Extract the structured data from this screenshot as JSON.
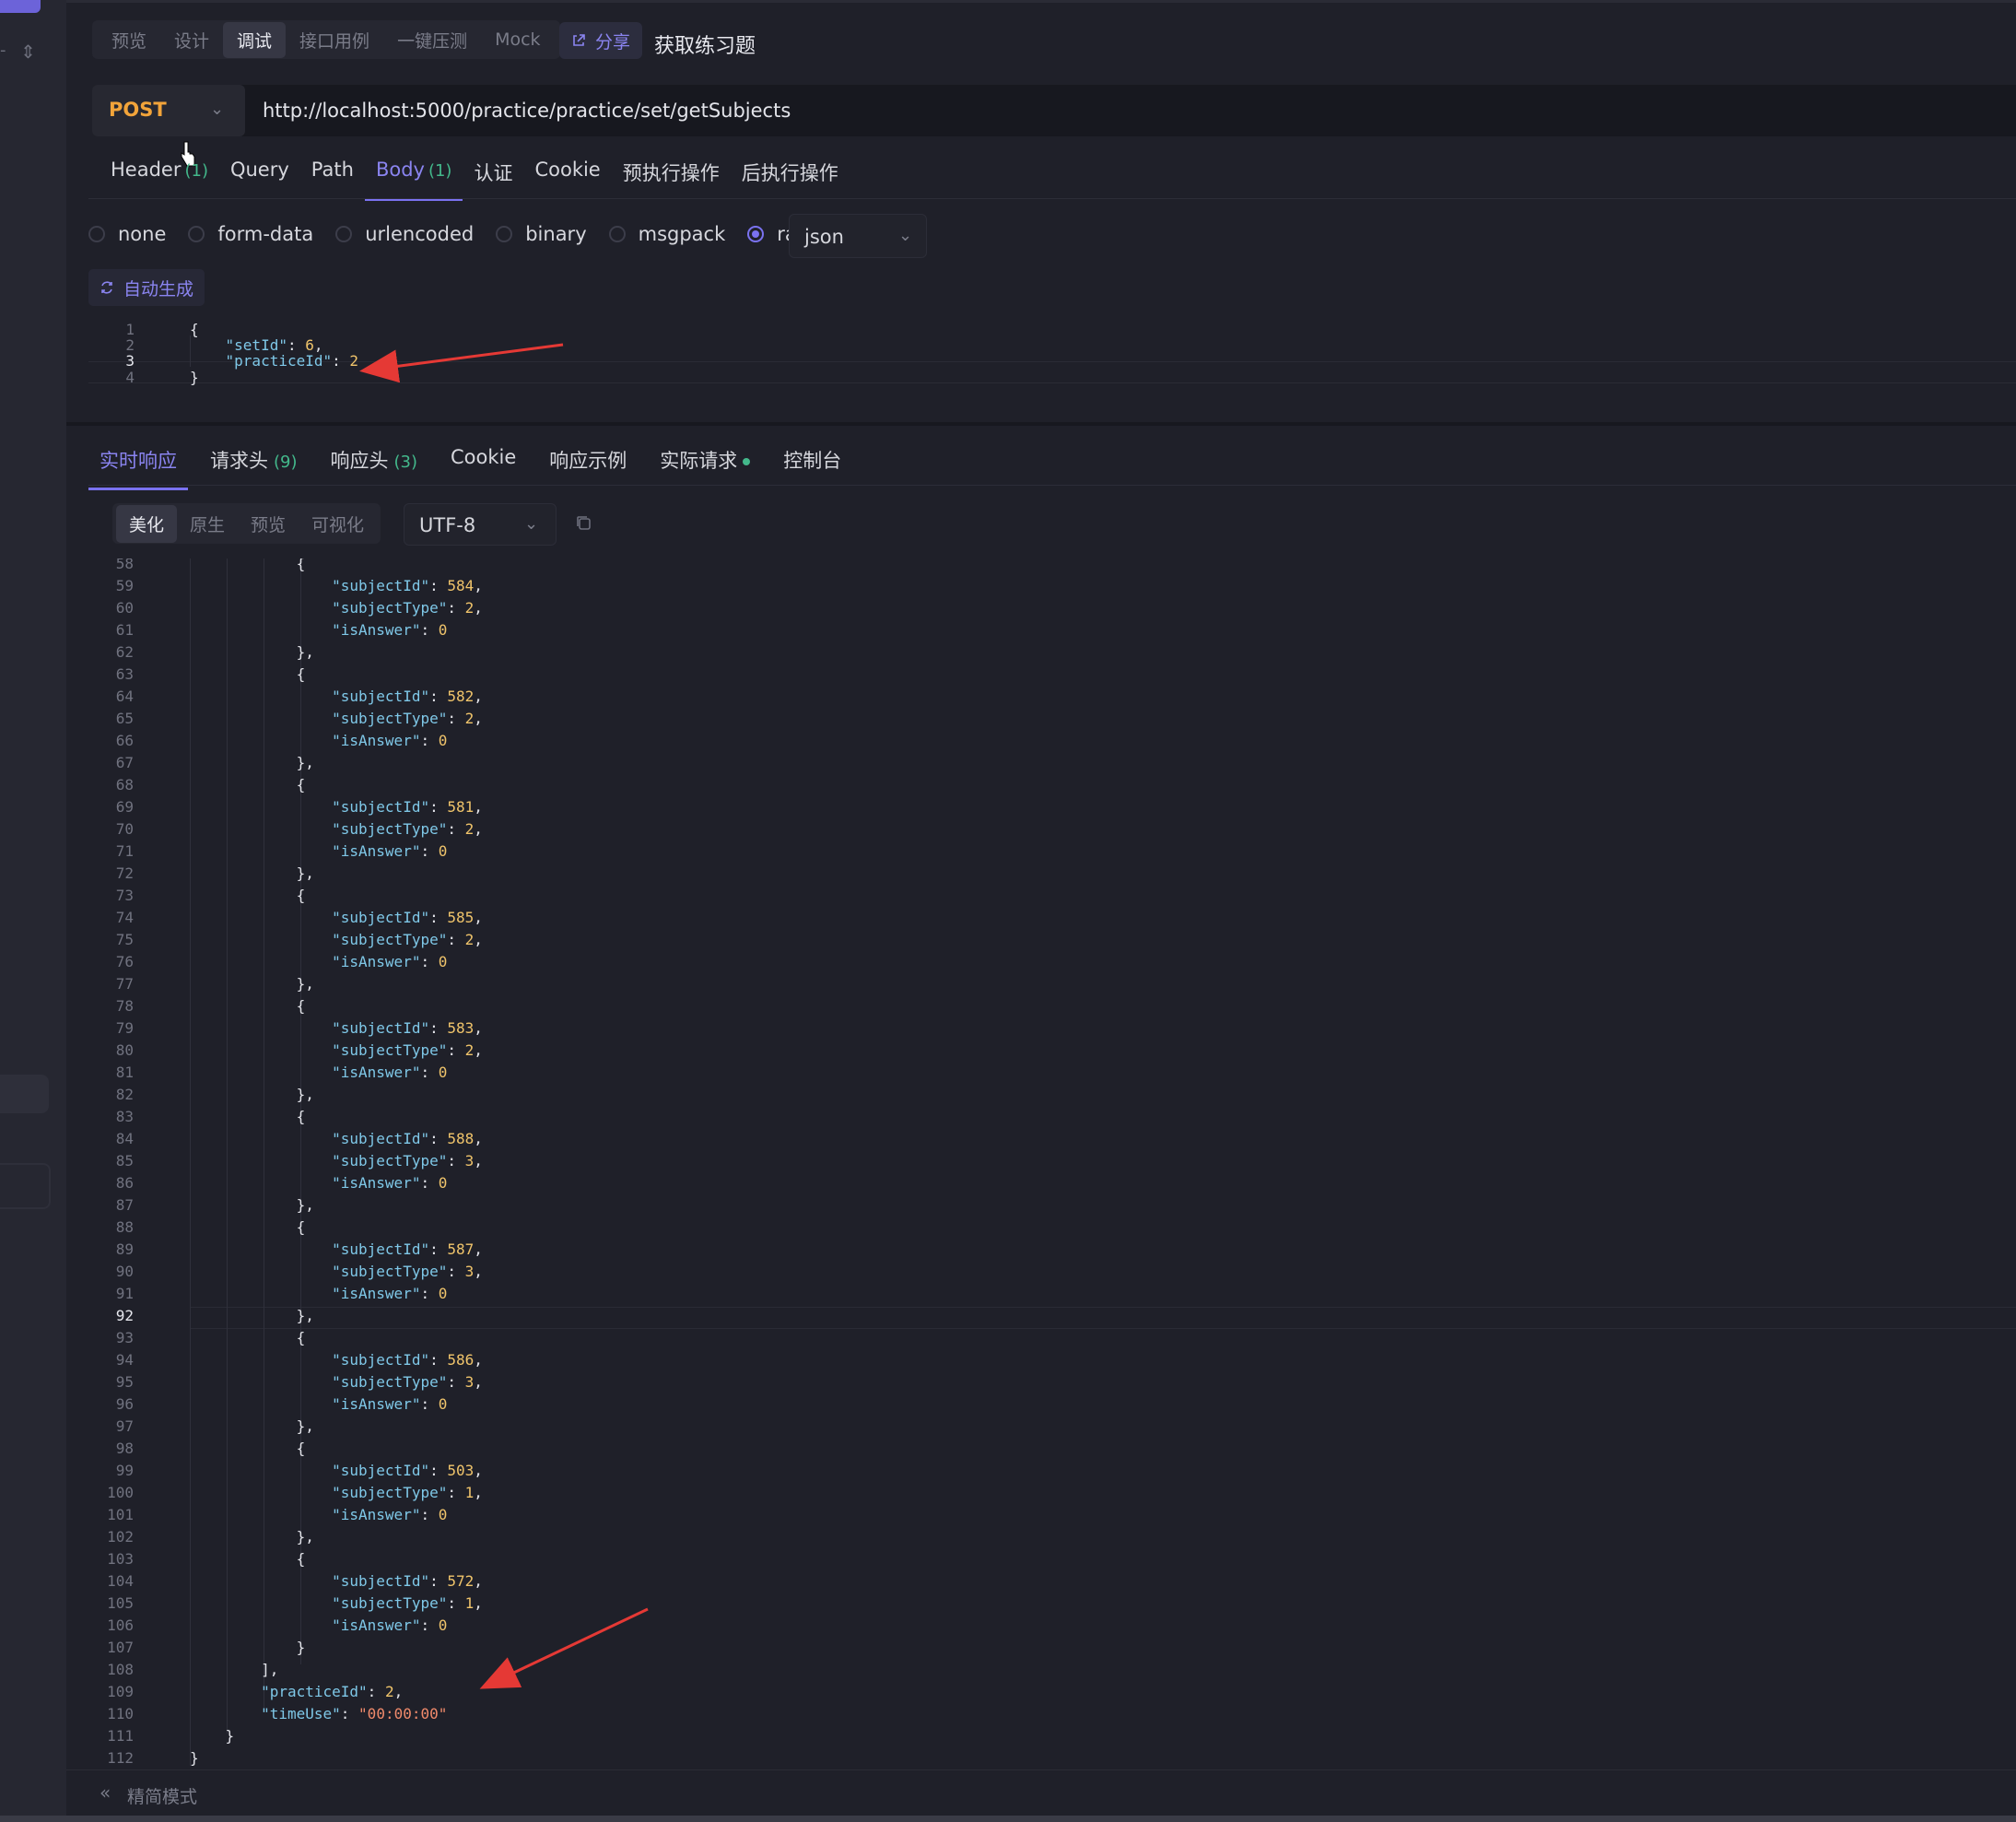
{
  "mode_tabs": [
    "预览",
    "设计",
    "调试",
    "接口用例",
    "一键压测",
    "Mock"
  ],
  "share_label": "分享",
  "api_title": "获取练习题",
  "method": "POST",
  "url": "http://localhost:5000/practice/practice/set/getSubjects",
  "request_tabs": [
    {
      "label": "Header",
      "count": "(1)"
    },
    {
      "label": "Query",
      "count": ""
    },
    {
      "label": "Path",
      "count": ""
    },
    {
      "label": "Body",
      "count": "(1)"
    },
    {
      "label": "认证",
      "count": ""
    },
    {
      "label": "Cookie",
      "count": ""
    },
    {
      "label": "预执行操作",
      "count": ""
    },
    {
      "label": "后执行操作",
      "count": ""
    }
  ],
  "body_types": [
    "none",
    "form-data",
    "urlencoded",
    "binary",
    "msgpack",
    "raw"
  ],
  "body_type_selected": "raw",
  "raw_format": "json",
  "autogen_label": "自动生成",
  "request_body_lines": [
    {
      "n": "1",
      "t": "{"
    },
    {
      "n": "2",
      "t": "    \"setId\": 6,"
    },
    {
      "n": "3",
      "t": "    \"practiceId\": 2"
    },
    {
      "n": "4",
      "t": "}"
    }
  ],
  "response_tabs": [
    {
      "label": "实时响应",
      "count": ""
    },
    {
      "label": "请求头",
      "count": "(9)"
    },
    {
      "label": "响应头",
      "count": "(3)"
    },
    {
      "label": "Cookie",
      "count": ""
    },
    {
      "label": "响应示例",
      "count": ""
    },
    {
      "label": "实际请求",
      "count": ""
    },
    {
      "label": "控制台",
      "count": ""
    }
  ],
  "view_tabs": [
    "美化",
    "原生",
    "预览",
    "可视化"
  ],
  "encoding": "UTF-8",
  "response_first_line": 58,
  "response_current_line": 92,
  "response_body_lines": [
    "            {",
    "                \"subjectId\": 584,",
    "                \"subjectType\": 2,",
    "                \"isAnswer\": 0",
    "            },",
    "            {",
    "                \"subjectId\": 582,",
    "                \"subjectType\": 2,",
    "                \"isAnswer\": 0",
    "            },",
    "            {",
    "                \"subjectId\": 581,",
    "                \"subjectType\": 2,",
    "                \"isAnswer\": 0",
    "            },",
    "            {",
    "                \"subjectId\": 585,",
    "                \"subjectType\": 2,",
    "                \"isAnswer\": 0",
    "            },",
    "            {",
    "                \"subjectId\": 583,",
    "                \"subjectType\": 2,",
    "                \"isAnswer\": 0",
    "            },",
    "            {",
    "                \"subjectId\": 588,",
    "                \"subjectType\": 3,",
    "                \"isAnswer\": 0",
    "            },",
    "            {",
    "                \"subjectId\": 587,",
    "                \"subjectType\": 3,",
    "                \"isAnswer\": 0",
    "            },",
    "            {",
    "                \"subjectId\": 586,",
    "                \"subjectType\": 3,",
    "                \"isAnswer\": 0",
    "            },",
    "            {",
    "                \"subjectId\": 503,",
    "                \"subjectType\": 1,",
    "                \"isAnswer\": 0",
    "            },",
    "            {",
    "                \"subjectId\": 572,",
    "                \"subjectType\": 1,",
    "                \"isAnswer\": 0",
    "            }",
    "        ],",
    "        \"practiceId\": 2,",
    "        \"timeUse\": \"00:00:00\"",
    "    }",
    "}"
  ],
  "footer_label": "精简模式",
  "colors": {
    "accent": "#7a72f0",
    "method": "#f2a43a",
    "key": "#7fc8e8",
    "number": "#f0c46b",
    "string": "#f08a6b",
    "count": "#43b88b",
    "arrow": "#e53935"
  },
  "icons": [
    "share-icon",
    "refresh-icon",
    "copy-icon",
    "chevron-down-icon",
    "double-chevron-left-icon",
    "mouse-cursor-icon",
    "red-arrow-annotation"
  ]
}
